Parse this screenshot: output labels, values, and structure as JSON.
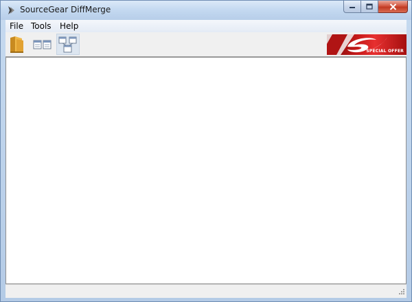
{
  "window": {
    "title": "SourceGear DiffMerge",
    "icon": "diffmerge-app-icon",
    "caption_buttons": [
      "minimize-icon",
      "maximize-icon",
      "close-icon"
    ]
  },
  "menu": {
    "items": [
      {
        "label": "File"
      },
      {
        "label": "Tools"
      },
      {
        "label": "Help"
      }
    ]
  },
  "toolbar": {
    "buttons": [
      {
        "icon": "open-folder-icon"
      },
      {
        "icon": "file-diff-icon"
      },
      {
        "icon": "file-merge-icon"
      }
    ],
    "banner": {
      "text": "SPECIAL OFFER"
    }
  },
  "colors": {
    "titlebar": "#c3d8f0",
    "close_button": "#c13a23",
    "banner": "#c81a1a"
  }
}
